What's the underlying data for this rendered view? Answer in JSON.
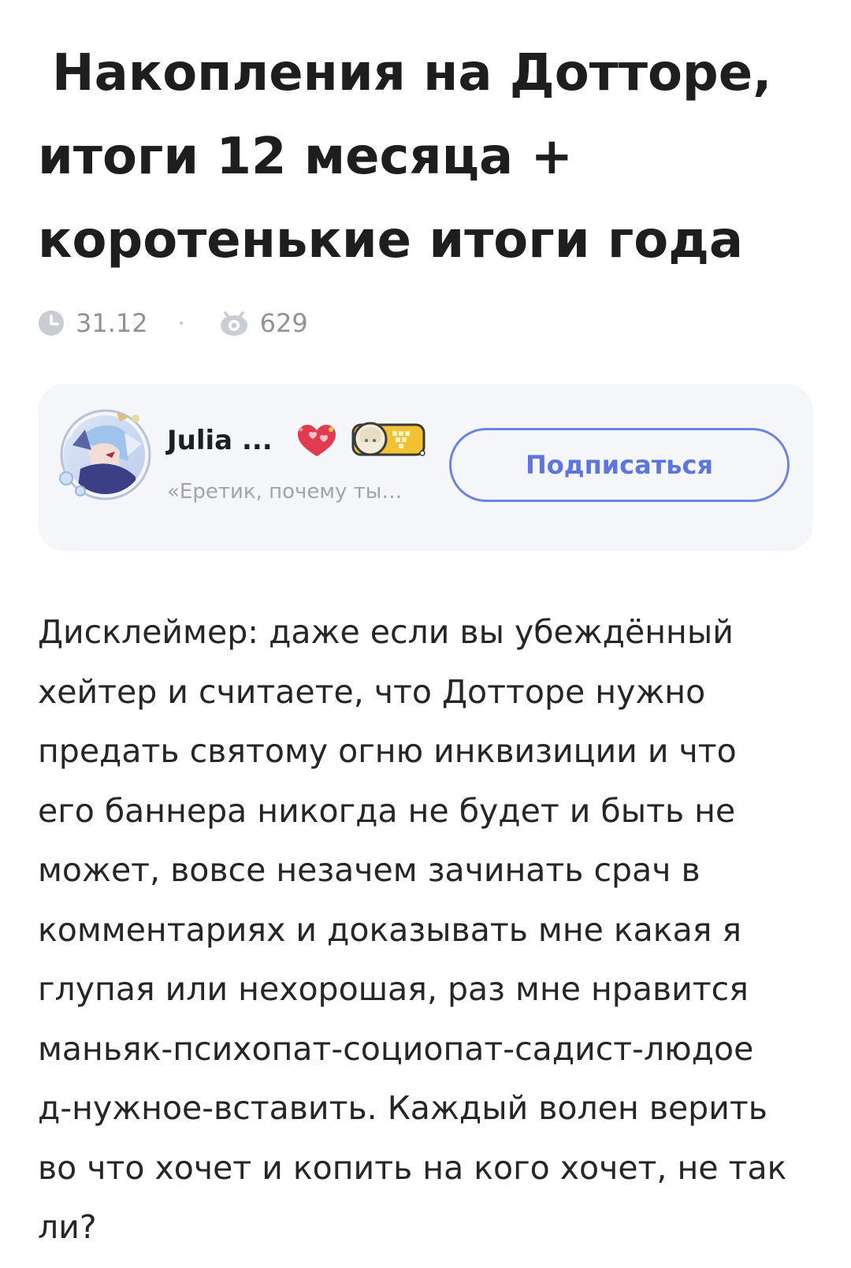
{
  "article": {
    "title_lines": [
      "Накопления на Дотторе,",
      "итоги 12 месяца +",
      "коротенькие итоги года"
    ],
    "date": "31.12",
    "views": "629"
  },
  "author": {
    "name": "Julia ...",
    "status": "«Еретик, почему ты…",
    "subscribe_label": "Подписаться"
  },
  "icons": {
    "date": "clock-icon",
    "views": "eye-icon",
    "badge": "heart-badge-icon",
    "frame": "character-frame-icon"
  },
  "colors": {
    "accent": "#5d76df",
    "card_bg": "#f5f6fa",
    "meta_text": "#8f9399"
  },
  "body": {
    "lines": [
      "Дисклеймер: даже если вы убеждённый",
      "хейтер и считаете, что Дотторе нужно",
      "предать святому огню инквизиции и что",
      "его баннера никогда не будет и быть не",
      "может, вовсе незачем зачинать срач в",
      "комментариях и доказывать мне какая я",
      "глупая или нехорошая, раз мне нравится",
      "маньяк-психопат-социопат-садист-людое",
      "д-нужное-вставить. Каждый волен верить",
      "во что хочет и копить на кого хочет, не так",
      "ли?"
    ]
  }
}
